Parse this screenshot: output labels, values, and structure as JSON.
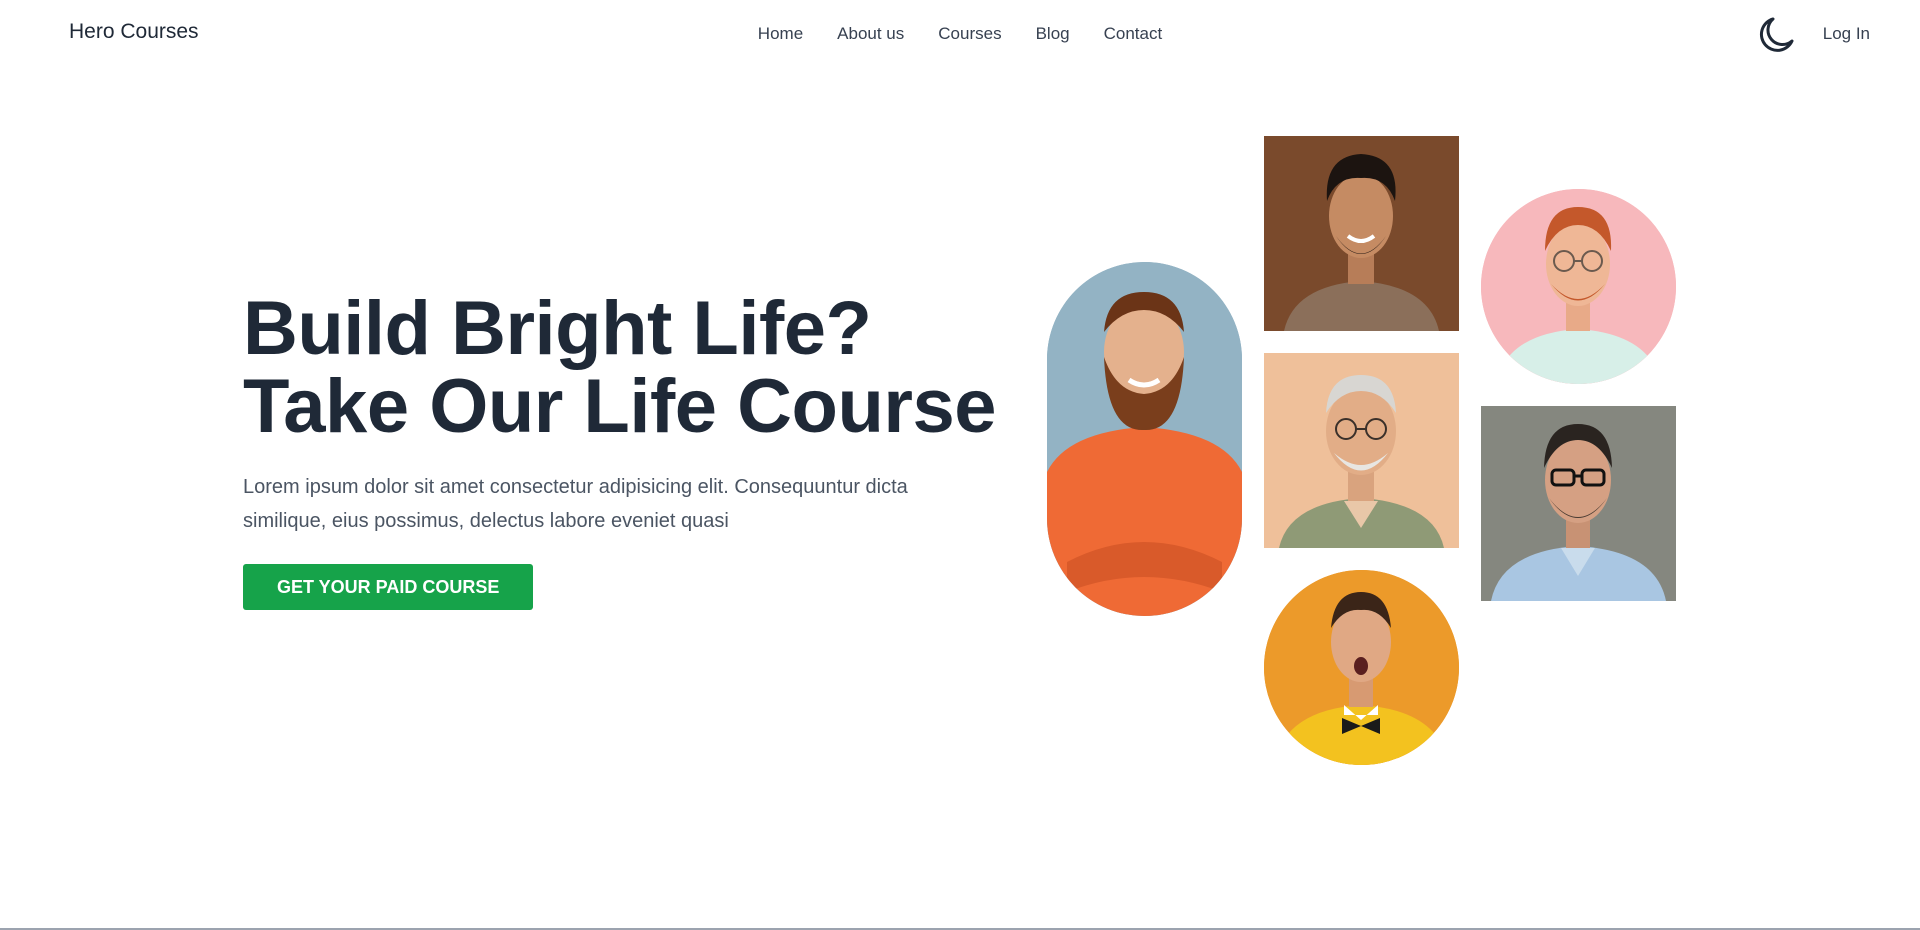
{
  "navbar": {
    "brand": "Hero Courses",
    "links": [
      "Home",
      "About us",
      "Courses",
      "Blog",
      "Contact"
    ],
    "theme_icon": "moon-icon",
    "login_label": "Log In"
  },
  "hero": {
    "title_line1": "Build Bright Life?",
    "title_line2": "Take Our Life Course",
    "description": "Lorem ipsum dolor sit amet consectetur adipisicing elit. Consequuntur dicta similique, eius possimus, delectus labore eveniet quasi",
    "cta_label": "GET YOUR PAID COURSE"
  },
  "colors": {
    "accent": "#16a34a",
    "heading": "#1f2937",
    "body_text": "#4b5563"
  }
}
